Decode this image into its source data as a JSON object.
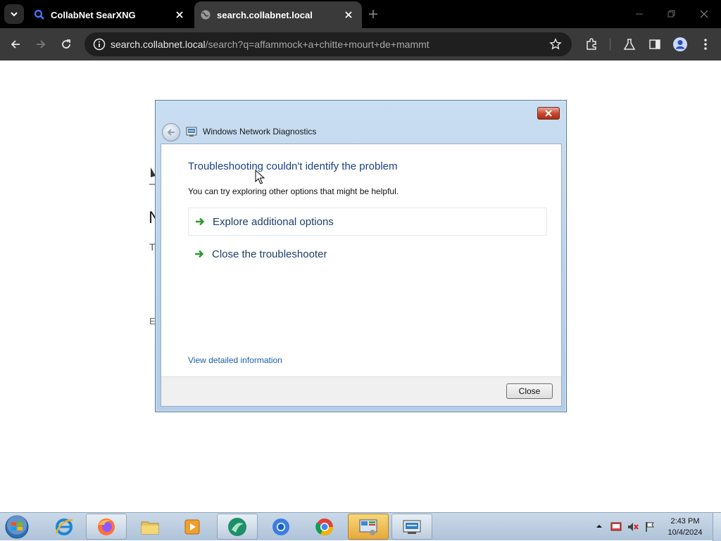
{
  "browser": {
    "tabs": [
      {
        "title": "CollabNet SearXNG",
        "icon": "search-icon",
        "active": false
      },
      {
        "title": "search.collabnet.local",
        "icon": "globe-icon",
        "active": true
      }
    ],
    "address": {
      "host": "search.collabnet.local",
      "path": "/search?q=affammock+a+chitte+mourt+de+mammt"
    }
  },
  "page_fragments": {
    "heading_char": "N",
    "text_char": "T",
    "footer_char": "E"
  },
  "dialog": {
    "title": "Windows Network Diagnostics",
    "heading": "Troubleshooting couldn't identify the problem",
    "subtext": "You can try exploring other options that might be helpful.",
    "options": [
      {
        "label": "Explore additional options"
      },
      {
        "label": "Close the troubleshooter"
      }
    ],
    "details_link": "View detailed information",
    "close_button": "Close"
  },
  "taskbar": {
    "apps": [
      "internet-explorer",
      "firefox",
      "file-explorer",
      "media-player",
      "app-green",
      "chrome-blue",
      "chrome",
      "control-panel",
      "network-diagnostics"
    ],
    "clock": {
      "time": "2:43 PM",
      "date": "10/4/2024"
    }
  },
  "colors": {
    "accent_link": "#1e5fa6",
    "heading_blue": "#1e3f86",
    "arrow_green": "#2a9a2a"
  }
}
